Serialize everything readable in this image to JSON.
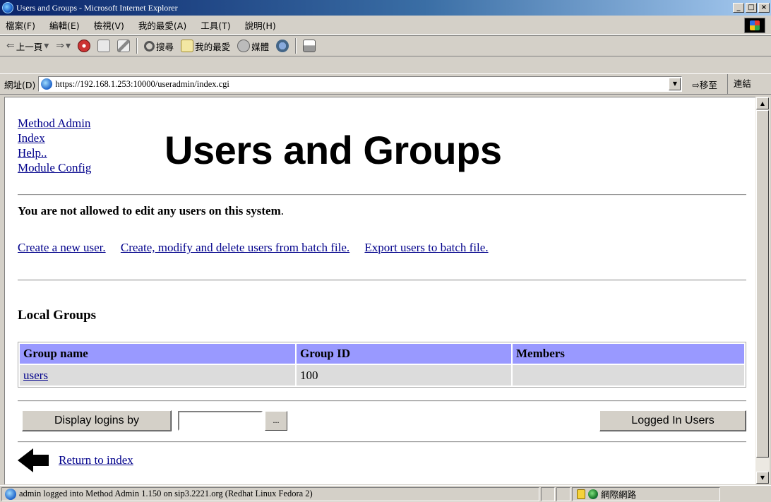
{
  "window": {
    "title": "Users and Groups - Microsoft Internet Explorer",
    "min": "_",
    "max": "□",
    "close": "×"
  },
  "menu": [
    "檔案(F)",
    "編輯(E)",
    "檢視(V)",
    "我的最愛(A)",
    "工具(T)",
    "說明(H)"
  ],
  "toolbar": {
    "back": "上一頁",
    "search": "搜尋",
    "favorites": "我的最愛",
    "media": "媒體"
  },
  "address": {
    "label": "網址(D)",
    "url": "https://192.168.1.253:10000/useradmin/index.cgi",
    "go": "移至",
    "links": "連結"
  },
  "page": {
    "side_links": [
      "Method Admin",
      "Index",
      "Help..",
      "Module Config"
    ],
    "title": "Users and Groups",
    "message": "You are not allowed to edit any users on this system",
    "message_end": ".",
    "action_links": [
      "Create a new user.",
      "Create, modify and delete users from batch file.",
      "Export users to batch file."
    ],
    "groups_heading": "Local Groups",
    "table": {
      "headers": [
        "Group name",
        "Group ID",
        "Members"
      ],
      "rows": [
        [
          "users",
          "100",
          ""
        ]
      ]
    },
    "display_button": "Display logins by",
    "display_input": "",
    "ellipsis": "...",
    "logged_button": "Logged In Users",
    "return_link": "Return to index"
  },
  "status": {
    "text": "admin logged into Method Admin 1.150 on sip3.2221.org (Redhat Linux Fedora 2)",
    "zone": "網際網路"
  }
}
